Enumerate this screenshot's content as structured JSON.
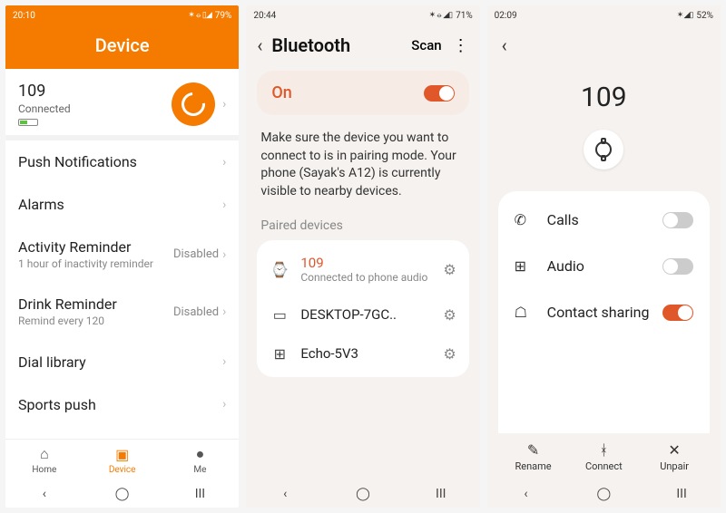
{
  "accent": "#f47b00",
  "phone1": {
    "status": {
      "time": "20:10",
      "battery": "79%"
    },
    "header": "Device",
    "device": {
      "name": "109",
      "status": "Connected"
    },
    "items": [
      {
        "title": "Push Notifications",
        "sub": "",
        "right": ""
      },
      {
        "title": "Alarms",
        "sub": "",
        "right": ""
      },
      {
        "title": "Activity Reminder",
        "sub": "1 hour of inactivity reminder",
        "right": "Disabled"
      },
      {
        "title": "Drink Reminder",
        "sub": "Remind every 120",
        "right": "Disabled"
      },
      {
        "title": "Dial library",
        "sub": "",
        "right": ""
      },
      {
        "title": "Sports push",
        "sub": "",
        "right": ""
      }
    ],
    "nav": {
      "home": "Home",
      "device": "Device",
      "me": "Me"
    }
  },
  "phone2": {
    "status": {
      "time": "20:44",
      "battery": "71%"
    },
    "title": "Bluetooth",
    "scan": "Scan",
    "on": "On",
    "info": "Make sure the device you want to connect to is in pairing mode. Your phone (Sayak's A12) is currently visible to nearby devices.",
    "section": "Paired devices",
    "devices": [
      {
        "name": "109",
        "sub": "Connected to phone audio",
        "accent": true,
        "icon": "watch"
      },
      {
        "name": "DESKTOP-7GC..",
        "sub": "",
        "accent": false,
        "icon": "laptop"
      },
      {
        "name": "Echo-5V3",
        "sub": "",
        "accent": false,
        "icon": "grid"
      }
    ]
  },
  "phone3": {
    "status": {
      "time": "02:09",
      "battery": "52%"
    },
    "name": "109",
    "rows": [
      {
        "label": "Calls",
        "on": false,
        "icon": "phone"
      },
      {
        "label": "Audio",
        "on": false,
        "icon": "grid"
      },
      {
        "label": "Contact sharing",
        "on": true,
        "icon": "contact"
      }
    ],
    "actions": {
      "rename": "Rename",
      "connect": "Connect",
      "unpair": "Unpair"
    }
  }
}
